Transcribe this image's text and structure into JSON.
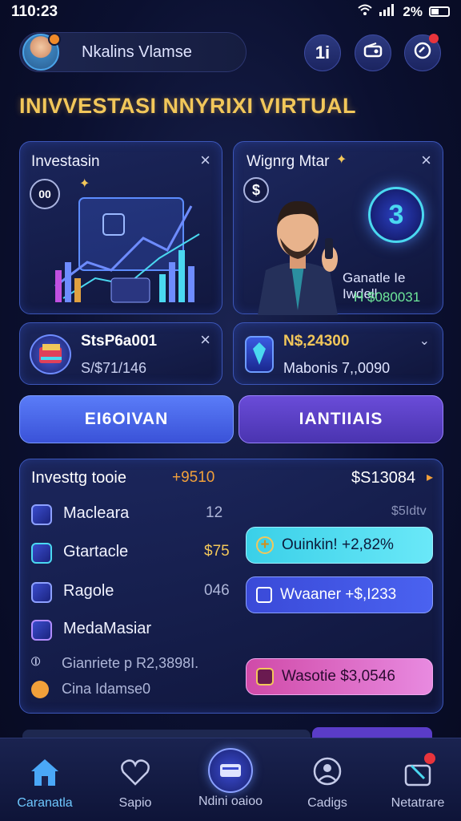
{
  "status_bar": {
    "time": "110:23",
    "battery": "2%"
  },
  "header": {
    "user_name": "Nkalins Vlamse",
    "btn_chat_label": "1i"
  },
  "page_title": "INIVVESTASI NNYRIXI VIRTUAL",
  "card_invest": {
    "title": "Investasin",
    "chip": "00"
  },
  "card_manager": {
    "title": "Wignrg Mtar",
    "chip": "$",
    "coin_number": "3",
    "caption": "Ganatle Ie Iwdell",
    "amount": "H $080031"
  },
  "card_stock": {
    "title": "StsP6a001",
    "subtitle": "S/$71/146"
  },
  "card_balance": {
    "amount": "N$,24300",
    "label": "Mabonis 7,,0090"
  },
  "buttons": {
    "left": "EI6OIVAN",
    "right": "IANTIIAIS"
  },
  "list_panel": {
    "title": "Investtg tooie",
    "title_delta": "+9510",
    "total": "$S13084",
    "sub_total": "$5Idtv",
    "rows": [
      {
        "label": "Macleara",
        "value": "12",
        "icon": "leaf-icon"
      },
      {
        "label": "Gtartacle",
        "value": "$75",
        "icon": "card-icon"
      },
      {
        "label": "Ragole",
        "value": "046",
        "icon": "square-icon"
      },
      {
        "label": "MedaMasiar",
        "value": "",
        "icon": "tag-icon"
      }
    ],
    "footer_1": "Gianriete p R2,3898I.",
    "footer_2": "Cina Idamse0",
    "pills": [
      {
        "text": "Ouinkin! +2,82%",
        "color": "#4ad8f0"
      },
      {
        "text": "Wvaaner +$,I233",
        "color": "#3a56e0"
      },
      {
        "text": "Wasotie $3,0546",
        "color": "#e06ac8"
      }
    ]
  },
  "nav": [
    {
      "label": "Caranatla",
      "icon": "home-icon"
    },
    {
      "label": "Sapio",
      "icon": "heart-icon"
    },
    {
      "label": "Ndini oaioo",
      "icon": "wallet-icon"
    },
    {
      "label": "Cadigs",
      "icon": "chat-icon"
    },
    {
      "label": "Netatrare",
      "icon": "gift-icon"
    }
  ],
  "colors": {
    "accent": "#4a6cf0",
    "title_gold": "#f2c75a",
    "bg": "#0b1030"
  }
}
